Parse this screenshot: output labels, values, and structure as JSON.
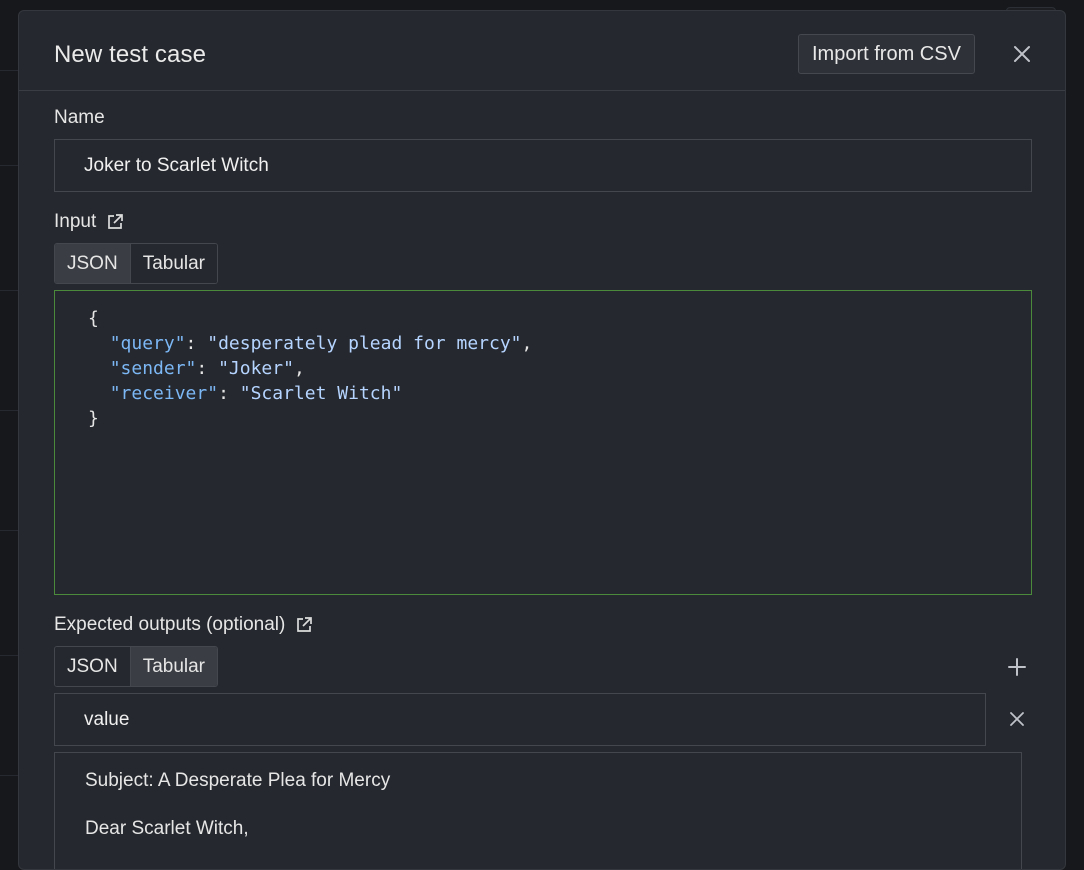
{
  "modal": {
    "title": "New test case",
    "import_label": "Import from CSV"
  },
  "name_field": {
    "label": "Name",
    "value": "Joker to Scarlet Witch"
  },
  "input_section": {
    "label": "Input",
    "modes": [
      "JSON",
      "Tabular"
    ],
    "active_mode": "JSON",
    "json": [
      {
        "indent": "{"
      },
      {
        "key": "\"query\"",
        "sep": ": ",
        "val": "\"desperately plead for mercy\"",
        "end": ","
      },
      {
        "key": "\"sender\"",
        "sep": ": ",
        "val": "\"Joker\"",
        "end": ","
      },
      {
        "key": "\"receiver\"",
        "sep": ": ",
        "val": "\"Scarlet Witch\"",
        "end": ""
      },
      {
        "indent": "}"
      }
    ]
  },
  "expected_section": {
    "label": "Expected outputs (optional)",
    "modes": [
      "JSON",
      "Tabular"
    ],
    "active_mode": "Tabular",
    "row_key": "value",
    "row_value_lines": [
      "Subject: A Desperate Plea for Mercy",
      "Dear Scarlet Witch,"
    ]
  },
  "icons": {
    "close": "close-icon",
    "external_link": "external-link-icon",
    "plus": "plus-icon"
  }
}
